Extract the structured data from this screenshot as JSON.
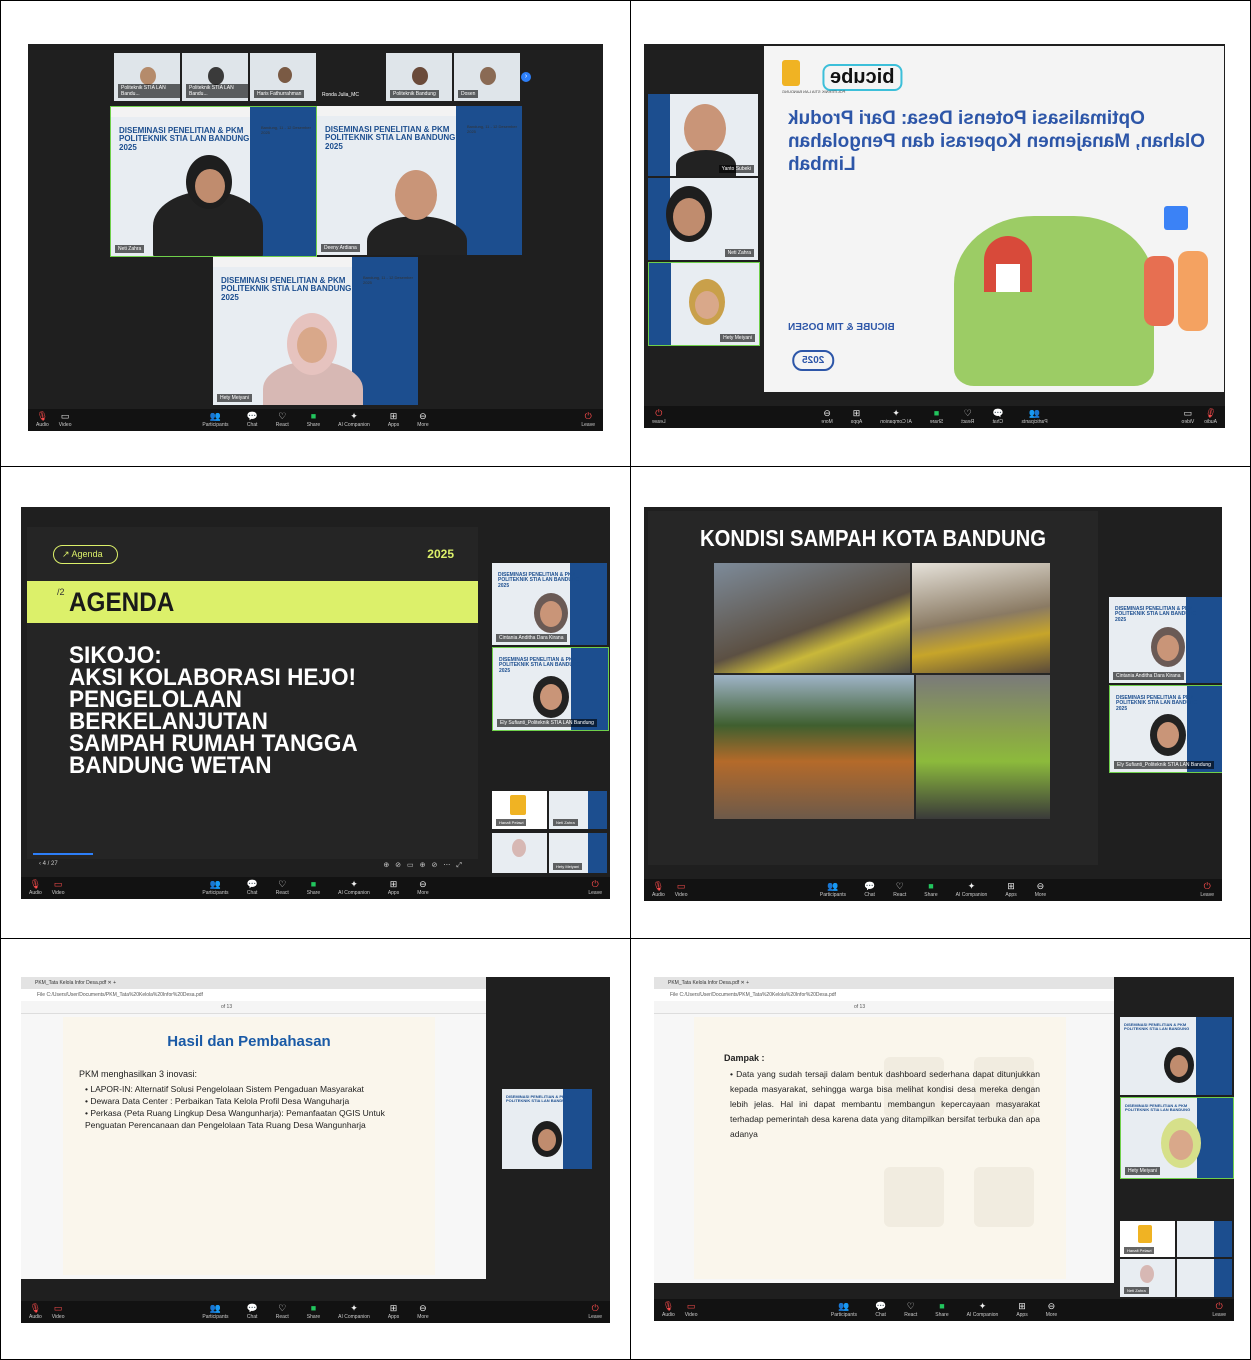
{
  "tile_title_line1": "DISEMINASI PENELITIAN & PKM",
  "tile_title_line2": "POLITEKNIK STIA LAN BANDUNG",
  "tile_title_line3": "2025",
  "tile_date": "Bandung, 11 - 12 Desember 2025",
  "zoom_toolbar": {
    "audio": "Audio",
    "video": "Video",
    "participants": "Participants",
    "chat": "Chat",
    "react": "React",
    "share": "Share",
    "ai": "AI Companion",
    "apps": "Apps",
    "more": "More",
    "leave": "Leave"
  },
  "panel1": {
    "names_top": [
      "Politeknik STIA LAN Bandu...",
      "Politeknik STIA LAN Bandu...",
      "Haris Fathurrahman",
      "Ronda Julia_MC",
      "Politeknik Bandung",
      "Dosen"
    ],
    "main_names": [
      "Neti Zahra",
      "Deeny Ardiana",
      "Hety Meiyani"
    ]
  },
  "panel2": {
    "slide_title": "Optimalisasi Potensi Desa: Dari Produk Olahan, Manajemen Koperasi dan Pengolahan Limbah",
    "logo": "bicube",
    "logo_sub": "POLITEKNIK STIA LAN BANDUNG",
    "team": "BICUBE & TIM DOSEN",
    "year": "2025",
    "names": [
      "Yanto Subeki",
      "Neti Zahra",
      "Hety Meiyani"
    ]
  },
  "panel3": {
    "tag": "Agenda",
    "year": "2025",
    "num": "/2",
    "heading": "AGENDA",
    "body": [
      "SIKOJO:",
      "AKSI KOLABORASI HEJO!",
      "PENGELOLAAN",
      "BERKELANJUTAN",
      "SAMPAH RUMAH TANGGA",
      "BANDUNG WETAN"
    ],
    "page": "4 / 27",
    "names": [
      "Cintania Anditha Dara Kirana",
      "Ely Sufianti_Politeknik STIA LAN Bandung",
      "Hanafi Pelawi",
      "Neti Zahra",
      "Hety Meiyani"
    ]
  },
  "panel4": {
    "heading": "KONDISI SAMPAH KOTA BANDUNG",
    "names": [
      "Cintania Anditha Dara Kirana",
      "Ely Sufianti_Politeknik STIA LAN Bandung"
    ]
  },
  "panel5": {
    "tab": "PKM_Tata Kelola Infor Desa.pdf",
    "url": "File  C:/Users/User/Documents/PKM_Tata%20Kelola%20Infor%20Desa.pdf",
    "page_ind": "of 13",
    "heading": "Hasil dan Pembahasan",
    "intro": "PKM menghasilkan 3 inovasi:",
    "items": [
      "LAPOR-IN: Alternatif Solusi Pengelolaan Sistem Pengaduan Masyarakat",
      "Dewara Data Center : Perbaikan Tata Kelola Profil Desa Wanguharja",
      "Perkasa (Peta Ruang Lingkup Desa Wangunharja): Pemanfaatan QGIS Untuk Penguatan Perencanaan dan Pengelolaan Tata Ruang Desa Wangunharja"
    ]
  },
  "panel6": {
    "tab": "PKM_Tata Kelola Infor Desa.pdf",
    "url": "File  C:/Users/User/Documents/PKM_Tata%20Kelola%20Infor%20Desa.pdf",
    "page_ind": "of 13",
    "heading": "Dampak :",
    "body": "Data yang sudah tersaji dalam bentuk dashboard sederhana dapat ditunjukkan kepada masyarakat, sehingga warga bisa melihat kondisi desa mereka dengan lebih jelas. Hal ini dapat membantu membangun kepercayaan masyarakat terhadap pemerintah desa karena data yang ditampilkan bersifat terbuka dan apa adanya",
    "names": [
      "Hety Meiyani",
      "Hanafi Pelawi",
      "Neti Zahra"
    ]
  }
}
